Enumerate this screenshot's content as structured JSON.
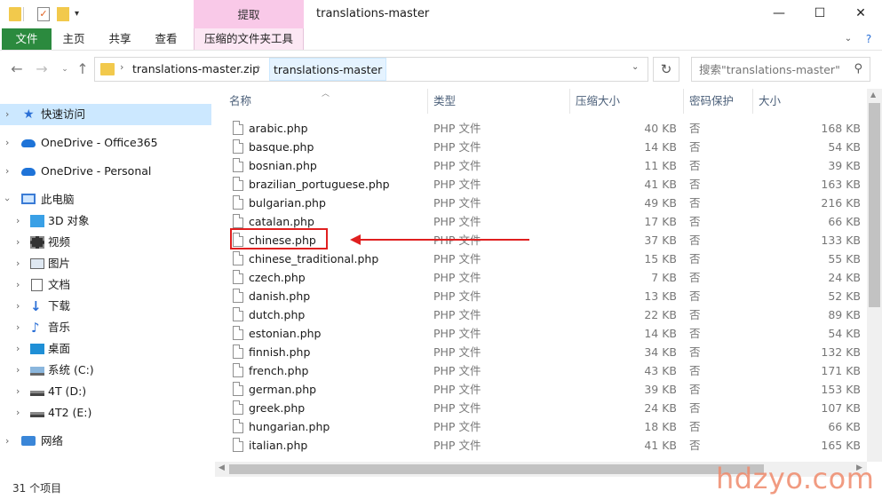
{
  "window": {
    "title": "translations-master",
    "context_tab_header": "提取",
    "buttons": {
      "minimize": "—",
      "maximize": "☐",
      "close": "✕"
    }
  },
  "ribbon": {
    "tabs": [
      "文件",
      "主页",
      "共享",
      "查看",
      "压缩的文件夹工具"
    ]
  },
  "navigation": {
    "breadcrumb": [
      "translations-master.zip",
      "translations-master"
    ],
    "search_placeholder": "搜索\"translations-master\""
  },
  "sidebar": {
    "items": [
      {
        "label": "快速访问",
        "icon": "star-icon",
        "level": 0,
        "selected": true
      },
      {
        "label": "OneDrive - Office365",
        "icon": "cloud-icon",
        "level": 0
      },
      {
        "label": "OneDrive - Personal",
        "icon": "cloud-icon",
        "level": 0
      },
      {
        "label": "此电脑",
        "icon": "computer-icon",
        "level": 0,
        "expanded": true
      },
      {
        "label": "3D 对象",
        "icon": "cube-icon",
        "level": 1
      },
      {
        "label": "视频",
        "icon": "video-icon",
        "level": 1
      },
      {
        "label": "图片",
        "icon": "picture-icon",
        "level": 1
      },
      {
        "label": "文档",
        "icon": "document-icon",
        "level": 1
      },
      {
        "label": "下载",
        "icon": "download-icon",
        "level": 1
      },
      {
        "label": "音乐",
        "icon": "music-icon",
        "level": 1
      },
      {
        "label": "桌面",
        "icon": "desktop-icon",
        "level": 1
      },
      {
        "label": "系统 (C:)",
        "icon": "system-drive-icon",
        "level": 1
      },
      {
        "label": "4T (D:)",
        "icon": "drive-icon",
        "level": 1
      },
      {
        "label": "4T2 (E:)",
        "icon": "drive-icon",
        "level": 1
      },
      {
        "label": "网络",
        "icon": "network-icon",
        "level": 0
      }
    ]
  },
  "columns": [
    "名称",
    "类型",
    "压缩大小",
    "密码保护",
    "大小"
  ],
  "files": [
    {
      "name": "arabic.php",
      "type": "PHP 文件",
      "compressed": "40 KB",
      "password": "否",
      "size": "168 KB"
    },
    {
      "name": "basque.php",
      "type": "PHP 文件",
      "compressed": "14 KB",
      "password": "否",
      "size": "54 KB"
    },
    {
      "name": "bosnian.php",
      "type": "PHP 文件",
      "compressed": "11 KB",
      "password": "否",
      "size": "39 KB"
    },
    {
      "name": "brazilian_portuguese.php",
      "type": "PHP 文件",
      "compressed": "41 KB",
      "password": "否",
      "size": "163 KB"
    },
    {
      "name": "bulgarian.php",
      "type": "PHP 文件",
      "compressed": "49 KB",
      "password": "否",
      "size": "216 KB"
    },
    {
      "name": "catalan.php",
      "type": "PHP 文件",
      "compressed": "17 KB",
      "password": "否",
      "size": "66 KB"
    },
    {
      "name": "chinese.php",
      "type": "PHP 文件",
      "compressed": "37 KB",
      "password": "否",
      "size": "133 KB"
    },
    {
      "name": "chinese_traditional.php",
      "type": "PHP 文件",
      "compressed": "15 KB",
      "password": "否",
      "size": "55 KB"
    },
    {
      "name": "czech.php",
      "type": "PHP 文件",
      "compressed": "7 KB",
      "password": "否",
      "size": "24 KB"
    },
    {
      "name": "danish.php",
      "type": "PHP 文件",
      "compressed": "13 KB",
      "password": "否",
      "size": "52 KB"
    },
    {
      "name": "dutch.php",
      "type": "PHP 文件",
      "compressed": "22 KB",
      "password": "否",
      "size": "89 KB"
    },
    {
      "name": "estonian.php",
      "type": "PHP 文件",
      "compressed": "14 KB",
      "password": "否",
      "size": "54 KB"
    },
    {
      "name": "finnish.php",
      "type": "PHP 文件",
      "compressed": "34 KB",
      "password": "否",
      "size": "132 KB"
    },
    {
      "name": "french.php",
      "type": "PHP 文件",
      "compressed": "43 KB",
      "password": "否",
      "size": "171 KB"
    },
    {
      "name": "german.php",
      "type": "PHP 文件",
      "compressed": "39 KB",
      "password": "否",
      "size": "153 KB"
    },
    {
      "name": "greek.php",
      "type": "PHP 文件",
      "compressed": "24 KB",
      "password": "否",
      "size": "107 KB"
    },
    {
      "name": "hungarian.php",
      "type": "PHP 文件",
      "compressed": "18 KB",
      "password": "否",
      "size": "66 KB"
    },
    {
      "name": "italian.php",
      "type": "PHP 文件",
      "compressed": "41 KB",
      "password": "否",
      "size": "165 KB"
    }
  ],
  "status": {
    "item_count": "31 个项目"
  },
  "watermark": "hdzyo.com",
  "colors": {
    "accent_file_tab": "#2b8a3e",
    "context_tab": "#f9c9e8",
    "selection": "#cce8ff",
    "annotation": "#e02020"
  }
}
